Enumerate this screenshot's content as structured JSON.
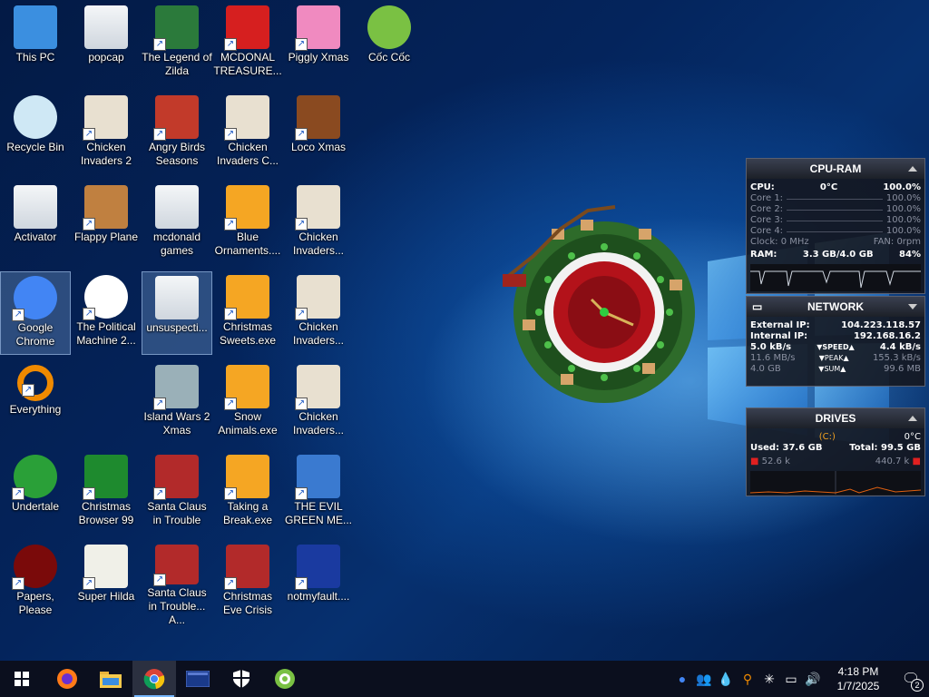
{
  "desktop": {
    "icons": [
      {
        "label": "This PC",
        "icon": "this-pc-icon"
      },
      {
        "label": "popcap",
        "icon": "folder-icon"
      },
      {
        "label": "The Legend of Zilda",
        "icon": "game-icon"
      },
      {
        "label": "MCDONAL TREASURE...",
        "icon": "mcdonalds-icon"
      },
      {
        "label": "Piggly Xmas",
        "icon": "pig-icon"
      },
      {
        "label": "Cốc Cốc",
        "icon": "coccoc-icon"
      },
      {
        "label": "Recycle Bin",
        "icon": "recycle-bin-icon"
      },
      {
        "label": "Chicken Invaders 2",
        "icon": "chicken-icon"
      },
      {
        "label": "Angry Birds Seasons",
        "icon": "angry-birds-icon"
      },
      {
        "label": "Chicken Invaders C...",
        "icon": "chicken-icon"
      },
      {
        "label": "Loco Xmas",
        "icon": "bear-icon"
      },
      {
        "label": "Activator",
        "icon": "folder-icon"
      },
      {
        "label": "Flappy Plane",
        "icon": "plane-icon"
      },
      {
        "label": "mcdonald games",
        "icon": "folder-icon"
      },
      {
        "label": "Blue Ornaments....",
        "icon": "puzzle-icon"
      },
      {
        "label": "Chicken Invaders...",
        "icon": "chicken-icon"
      },
      {
        "label": "Google Chrome",
        "icon": "chrome-icon"
      },
      {
        "label": "The Political Machine 2...",
        "icon": "political-icon"
      },
      {
        "label": "unsuspecti...",
        "icon": "folder-icon"
      },
      {
        "label": "Christmas Sweets.exe",
        "icon": "puzzle-icon"
      },
      {
        "label": "Chicken Invaders...",
        "icon": "chicken-icon"
      },
      {
        "label": "Everything",
        "icon": "search-icon"
      },
      {
        "label": "Island Wars 2 Xmas",
        "icon": "island-icon"
      },
      {
        "label": "Snow Animals.exe",
        "icon": "puzzle-icon"
      },
      {
        "label": "Chicken Invaders...",
        "icon": "chicken-icon"
      },
      {
        "label": "Undertale",
        "icon": "undertale-icon"
      },
      {
        "label": "Christmas Browser 99",
        "icon": "tree-icon"
      },
      {
        "label": "Santa Claus in Trouble",
        "icon": "santa-icon"
      },
      {
        "label": "Taking a Break.exe",
        "icon": "puzzle-icon"
      },
      {
        "label": "THE EVIL GREEN ME...",
        "icon": "messenger-icon"
      },
      {
        "label": "Papers, Please",
        "icon": "papers-icon"
      },
      {
        "label": "Super Hilda",
        "icon": "pixel-icon"
      },
      {
        "label": "Santa Claus in Trouble... A...",
        "icon": "santa-icon"
      },
      {
        "label": "Christmas Eve Crisis",
        "icon": "santa-icon"
      },
      {
        "label": "notmyfault....",
        "icon": "bsod-icon"
      }
    ]
  },
  "cpu_ram": {
    "title": "CPU-RAM",
    "cpu_label": "CPU:",
    "cpu_temp": "0°C",
    "cpu_pct": "100.0%",
    "cores": [
      {
        "label": "Core 1:",
        "value": "100.0%"
      },
      {
        "label": "Core 2:",
        "value": "100.0%"
      },
      {
        "label": "Core 3:",
        "value": "100.0%"
      },
      {
        "label": "Core 4:",
        "value": "100.0%"
      }
    ],
    "clock": "Clock: 0 MHz",
    "fan": "FAN: 0rpm",
    "ram_label": "RAM:",
    "ram_value": "3.3 GB/4.0 GB",
    "ram_pct": "84%"
  },
  "network": {
    "title": "NETWORK",
    "ext_label": "External IP:",
    "ext_ip": "104.223.118.57",
    "int_label": "Internal IP:",
    "int_ip": "192.168.16.2",
    "speed_down": "5.0 kB/s",
    "speed_label": "SPEED",
    "speed_up": "4.4 kB/s",
    "peak_down": "11.6 MB/s",
    "peak_label": "PEAK",
    "peak_up": "155.3 kB/s",
    "sum_down": "4.0 GB",
    "sum_label": "SUM",
    "sum_up": "99.6 MB"
  },
  "drives": {
    "title": "DRIVES",
    "drive": "(C:)",
    "temp": "0°C",
    "used": "Used: 37.6 GB",
    "total": "Total: 99.5 GB",
    "read": "52.6 k",
    "write": "440.7 k"
  },
  "taskbar": {
    "time": "4:18 PM",
    "date": "1/7/2025",
    "notifications": "2"
  }
}
